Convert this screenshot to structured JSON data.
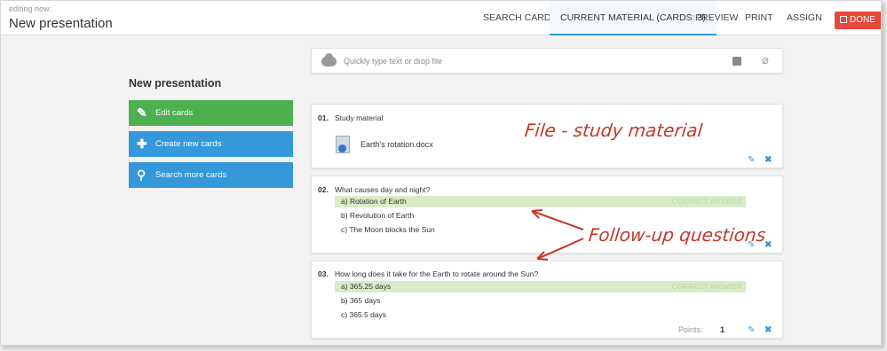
{
  "header": {
    "editing_label": "editing now:",
    "title": "New presentation",
    "tabs": [
      "SEARCH CARDS",
      "CURRENT MATERIAL (CARDS: 3)",
      "PREVIEW",
      "PRINT",
      "ASSIGN"
    ],
    "done_label": "DONE"
  },
  "sidebar": {
    "title": "New presentation",
    "buttons": [
      {
        "label": "Edit cards",
        "color": "#4caf50"
      },
      {
        "label": "Create new cards",
        "color": "#3498db"
      },
      {
        "label": "Search more cards",
        "color": "#3498db"
      }
    ]
  },
  "upload": {
    "placeholder": "Quickly type text or drop file"
  },
  "cards": [
    {
      "number": "01.",
      "title": "Study material",
      "file": "Earth's rotation.docx"
    },
    {
      "number": "02.",
      "question": "What causes day and night?",
      "answers": [
        {
          "letter": "a)",
          "text": "Rotation of Earth",
          "correct": true
        },
        {
          "letter": "b)",
          "text": "Revolution of Earth",
          "correct": false
        },
        {
          "letter": "c)",
          "text": "The Moon blocks the Sun",
          "correct": false
        }
      ],
      "correct_label": "CORRECT ANSWER"
    },
    {
      "number": "03.",
      "question": "How long does it take for the Earth to rotate around the Sun?",
      "answers": [
        {
          "letter": "a)",
          "text": "365.25 days",
          "correct": true
        },
        {
          "letter": "b)",
          "text": "365 days",
          "correct": false
        },
        {
          "letter": "c)",
          "text": "365.5 days",
          "correct": false
        }
      ],
      "correct_label": "CORRECT ANSWER",
      "points_label": "Points:",
      "points_value": "1"
    }
  ],
  "annotations": {
    "file_note": "File - study material",
    "followup_note": "Follow-up questions"
  },
  "colors": {
    "accent": "#3498db",
    "done": "#e8473b",
    "correct_bg": "#d9ecc9",
    "annotation": "#c0392b"
  }
}
